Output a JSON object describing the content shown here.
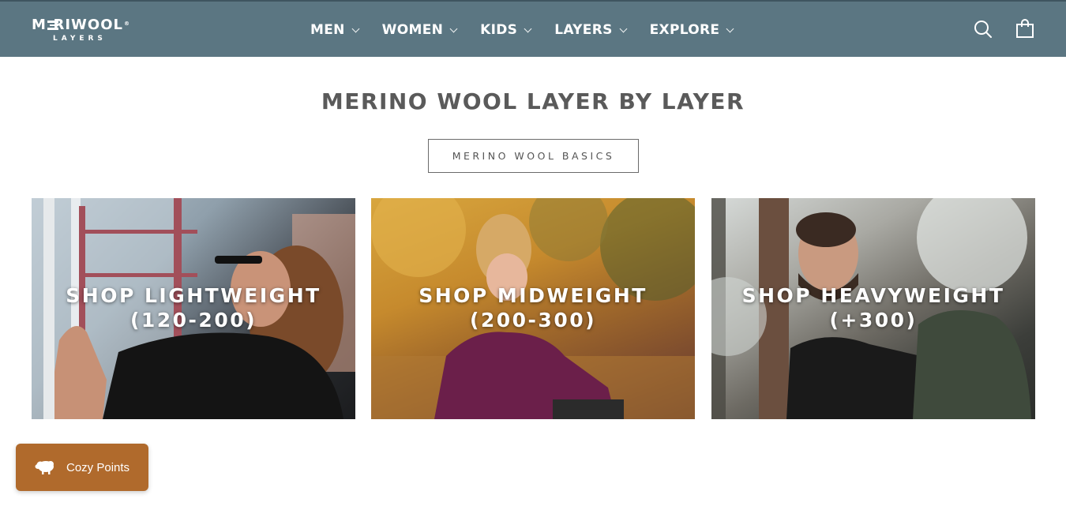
{
  "header": {
    "logo": {
      "main": "MERIWOOL",
      "sub": "LAYERS",
      "mark": "®"
    },
    "nav": [
      {
        "label": "MEN"
      },
      {
        "label": "WOMEN"
      },
      {
        "label": "KIDS"
      },
      {
        "label": "LAYERS"
      },
      {
        "label": "EXPLORE"
      }
    ],
    "icons": {
      "search": "search-icon",
      "cart": "shopping-bag-icon",
      "dropdown": "chevron-down-icon"
    },
    "background": "#5b7682"
  },
  "main": {
    "heading": "MERINO WOOL LAYER BY LAYER",
    "basics_button": "MERINO WOOL BASICS",
    "cards": [
      {
        "line1": "SHOP LIGHTWEIGHT",
        "line2": "(120-200)"
      },
      {
        "line1": "SHOP MIDWEIGHT",
        "line2": "(200-300)"
      },
      {
        "line1": "SHOP HEAVYWEIGHT",
        "line2": "(+300)"
      }
    ]
  },
  "rewards": {
    "label": "Cozy Points",
    "icon": "sheep-icon",
    "color": "#b06a2c"
  }
}
